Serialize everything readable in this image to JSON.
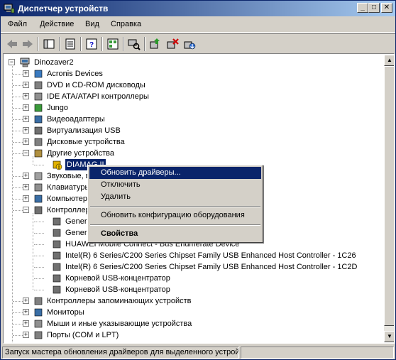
{
  "window": {
    "title": "Диспетчер устройств",
    "controls": {
      "minimize": "_",
      "maximize": "□",
      "close": "✕"
    }
  },
  "menu": [
    "Файл",
    "Действие",
    "Вид",
    "Справка"
  ],
  "toolbar": {
    "icons": [
      "back-arrow-icon",
      "forward-arrow-icon",
      "show-hide-tree-icon",
      "properties-icon",
      "help-icon",
      "view-icon",
      "scan-hardware-icon",
      "update-driver-icon",
      "uninstall-icon",
      "disable-icon"
    ]
  },
  "tree": {
    "root": "Dinozaver2",
    "items": [
      {
        "label": "Acronis Devices",
        "expand": "+"
      },
      {
        "label": "DVD и CD-ROM дисководы",
        "expand": "+"
      },
      {
        "label": "IDE ATA/ATAPI контроллеры",
        "expand": "+"
      },
      {
        "label": "Jungo",
        "expand": "+"
      },
      {
        "label": "Видеоадаптеры",
        "expand": "+"
      },
      {
        "label": "Виртуализация USB",
        "expand": "+"
      },
      {
        "label": "Дисковые устройства",
        "expand": "+"
      },
      {
        "label": "Другие устройства",
        "expand": "−"
      },
      {
        "label": "DIAMAG II",
        "child": true,
        "selected": true
      },
      {
        "label": "Звуковые, видео и игровые устройства",
        "expand": "+"
      },
      {
        "label": "Клавиатуры",
        "expand": "+"
      },
      {
        "label": "Компьютер",
        "expand": "+"
      },
      {
        "label": "Контроллеры USB",
        "expand": "−"
      },
      {
        "label": "Generic USB Hub",
        "child": true
      },
      {
        "label": "Generic USB Hub",
        "child": true
      },
      {
        "label": "HUAWEI Mobile Connect - Bus Enumerate Device",
        "child": true
      },
      {
        "label": "Intel(R) 6 Series/C200 Series Chipset Family USB Enhanced Host Controller - 1C26",
        "child": true
      },
      {
        "label": "Intel(R) 6 Series/C200 Series Chipset Family USB Enhanced Host Controller - 1C2D",
        "child": true
      },
      {
        "label": "Корневой USB-концентратор",
        "child": true
      },
      {
        "label": "Корневой USB-концентратор",
        "child": true
      },
      {
        "label": "Контроллеры запоминающих устройств",
        "expand": "+"
      },
      {
        "label": "Мониторы",
        "expand": "+"
      },
      {
        "label": "Мыши и иные указывающие устройства",
        "expand": "+"
      },
      {
        "label": "Порты (COM и LPT)",
        "expand": "+"
      }
    ]
  },
  "context_menu": {
    "items": [
      {
        "label": "Обновить драйверы...",
        "highlighted": true
      },
      {
        "label": "Отключить"
      },
      {
        "label": "Удалить"
      },
      {
        "label": "Обновить конфигурацию оборудования"
      },
      {
        "label": "Свойства",
        "bold": true
      }
    ]
  },
  "statusbar": {
    "text": "Запуск мастера обновления драйверов для выделенного устрой"
  },
  "colors": {
    "selection": "#0a246a",
    "face": "#d4d0c8"
  }
}
